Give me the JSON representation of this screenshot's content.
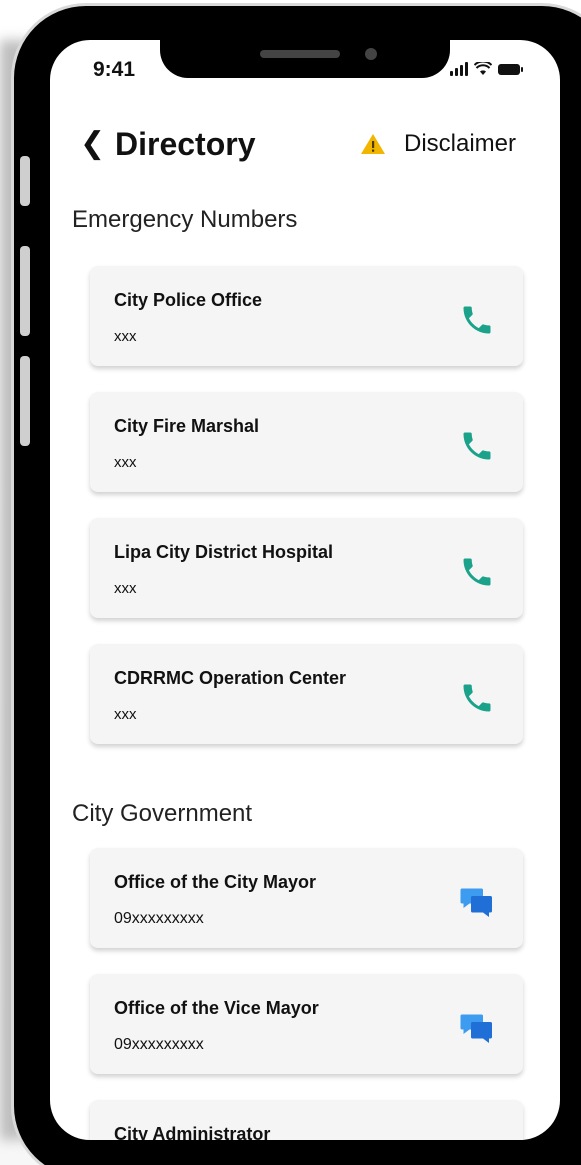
{
  "status_bar": {
    "time": "9:41"
  },
  "header": {
    "back_glyph": "❮",
    "title": "Directory",
    "disclaimer_label": "Disclaimer"
  },
  "sections": {
    "emergency": {
      "title": "Emergency Numbers",
      "items": [
        {
          "name": "City Police Office",
          "number": "xxx",
          "icon": "phone-icon"
        },
        {
          "name": "City Fire Marshal",
          "number": "xxx",
          "icon": "phone-icon"
        },
        {
          "name": "Lipa City District Hospital",
          "number": "xxx",
          "icon": "phone-icon"
        },
        {
          "name": "CDRRMC Operation Center",
          "number": "xxx",
          "icon": "phone-icon"
        }
      ]
    },
    "government": {
      "title": "City Government",
      "items": [
        {
          "name": "Office of the City Mayor",
          "number": "09xxxxxxxxx",
          "icon": "chat-icon"
        },
        {
          "name": "Office of the Vice Mayor",
          "number": "09xxxxxxxxx",
          "icon": "chat-icon"
        },
        {
          "name": "City Administrator",
          "number": "",
          "icon": "chat-icon"
        }
      ]
    }
  },
  "colors": {
    "phone_icon": "#1aa28a",
    "chat_icon": "#1f7de0",
    "warning": "#f2b500"
  }
}
